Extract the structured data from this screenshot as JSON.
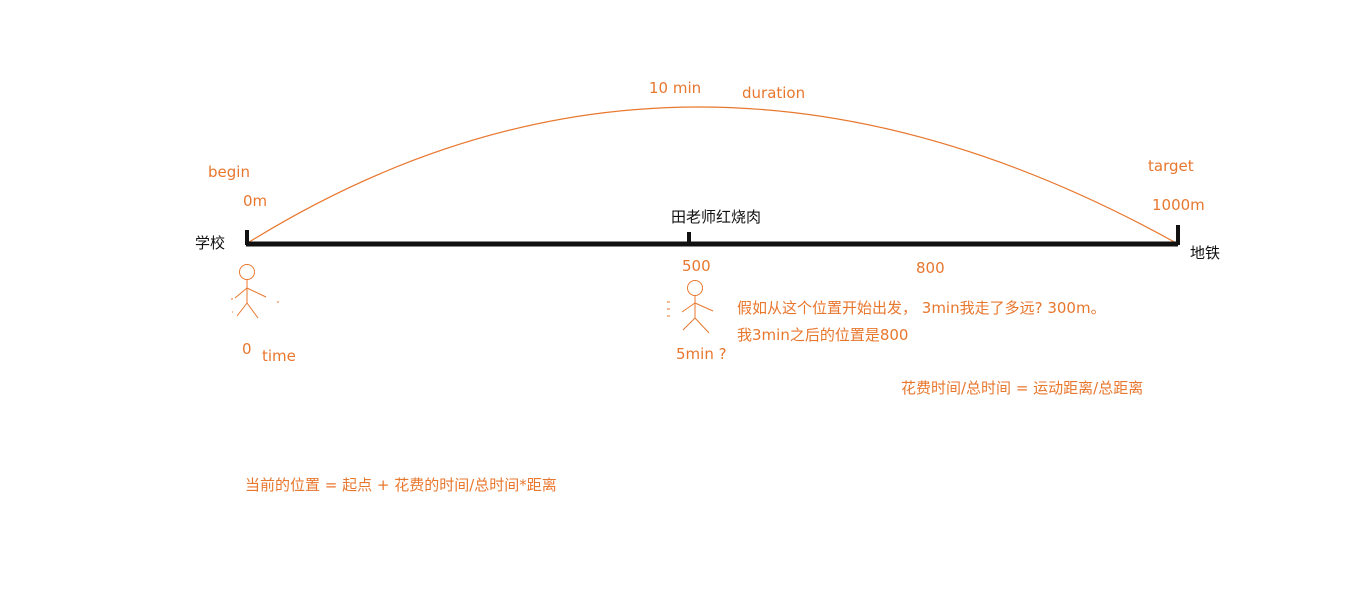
{
  "colors": {
    "annotation": "#e8772e",
    "line": "#111111",
    "background": "#ffffff"
  },
  "labels": {
    "duration_value": "10 min",
    "duration": "duration",
    "begin": "begin",
    "start_distance": "0m",
    "start_place": "学校",
    "target": "target",
    "end_distance": "1000m",
    "end_place": "地铁",
    "midpoint_place": "田老师红烧肉",
    "mid_distance": "500",
    "later_distance": "800",
    "start_time": "0",
    "time": "time",
    "mid_time": "5min ?",
    "question": "假如从这个位置开始出发， 3min我走了多远? 300m。",
    "answer": "我3min之后的位置是800",
    "ratio_formula": "花费时间/总时间 = 运动距离/总距离",
    "position_formula": "当前的位置 = 起点 + 花费的时间/总时间*距离"
  }
}
